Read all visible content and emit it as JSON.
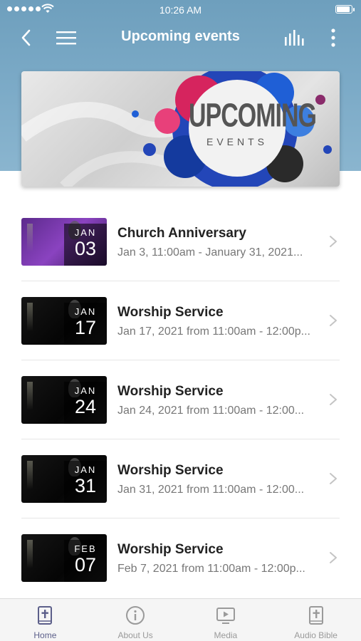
{
  "status_bar": {
    "time": "10:26 AM"
  },
  "nav": {
    "title": "Upcoming events"
  },
  "banner": {
    "line1": "UPCOMING",
    "line2": "EVENTS"
  },
  "events": [
    {
      "title": "Church Anniversary",
      "subtitle": "Jan 3, 11:00am - January 31, 2021...",
      "month": "JAN",
      "day": "03",
      "thumb": "purple"
    },
    {
      "title": "Worship Service",
      "subtitle": "Jan 17, 2021 from 11:00am - 12:00p...",
      "month": "JAN",
      "day": "17",
      "thumb": "dark"
    },
    {
      "title": "Worship Service",
      "subtitle": "Jan 24, 2021 from 11:00am - 12:00...",
      "month": "JAN",
      "day": "24",
      "thumb": "dark"
    },
    {
      "title": "Worship Service",
      "subtitle": "Jan 31, 2021 from 11:00am - 12:00...",
      "month": "JAN",
      "day": "31",
      "thumb": "dark"
    },
    {
      "title": "Worship Service",
      "subtitle": "Feb 7, 2021 from 11:00am - 12:00p...",
      "month": "FEB",
      "day": "07",
      "thumb": "dark"
    }
  ],
  "tabs": [
    {
      "label": "Home",
      "icon": "bible-cross-icon",
      "active": true
    },
    {
      "label": "About Us",
      "icon": "info-icon",
      "active": false
    },
    {
      "label": "Media",
      "icon": "media-play-icon",
      "active": false
    },
    {
      "label": "Audio Bible",
      "icon": "bible-cross-icon",
      "active": false
    }
  ],
  "colors": {
    "header": "#7aa9c6",
    "tab_active": "#5c5f8a",
    "tab_inactive": "#9a9a9a"
  }
}
